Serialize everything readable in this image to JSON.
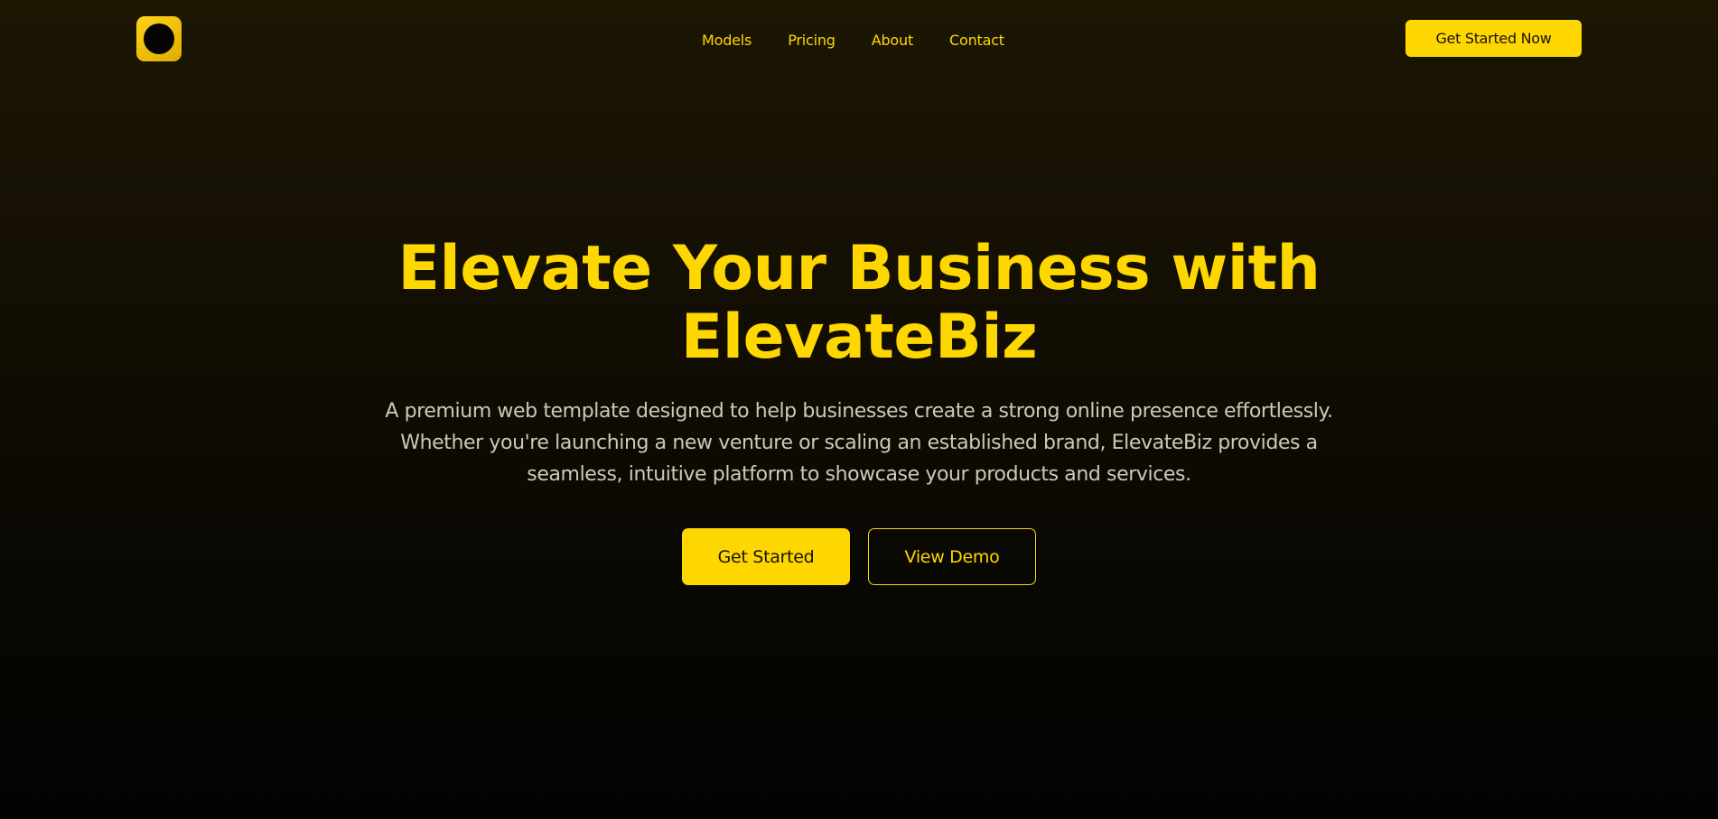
{
  "brand": {
    "logo_icon": "circle-logo-icon",
    "accent_color": "#ffd700"
  },
  "nav": {
    "links": [
      "Models",
      "Pricing",
      "About",
      "Contact"
    ],
    "cta_label": "Get Started Now"
  },
  "hero": {
    "title": "Elevate Your Business with ElevateBiz",
    "subtitle": "A premium web template designed to help businesses create a strong online presence effortlessly. Whether you're launching a new venture or scaling an established brand, ElevateBiz provides a seamless, intuitive platform to showcase your products and services.",
    "primary_button": "Get Started",
    "secondary_button": "View Demo"
  }
}
